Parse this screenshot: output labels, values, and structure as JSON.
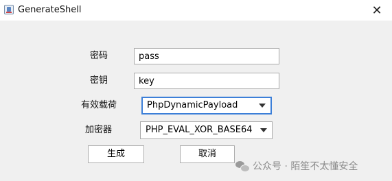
{
  "window": {
    "title": "GenerateShell",
    "close_glyph": "✕",
    "icon": "java-app-icon"
  },
  "form": {
    "password": {
      "label": "密码",
      "value": "pass"
    },
    "key": {
      "label": "密钥",
      "value": "key"
    },
    "payload": {
      "label": "有效载荷",
      "selected": "PhpDynamicPayload"
    },
    "cryption": {
      "label": "加密器",
      "selected": "PHP_EVAL_XOR_BASE64"
    }
  },
  "buttons": {
    "generate_label": "生成",
    "cancel_label": "取消"
  },
  "watermark": {
    "text": "公众号 · 陌笙不太懂安全",
    "icon": "wechat-icon"
  },
  "colors": {
    "focus_border": "#3c7fd8",
    "window_bg": "#f0f0f0",
    "titlebar_bg": "#ffffff"
  }
}
